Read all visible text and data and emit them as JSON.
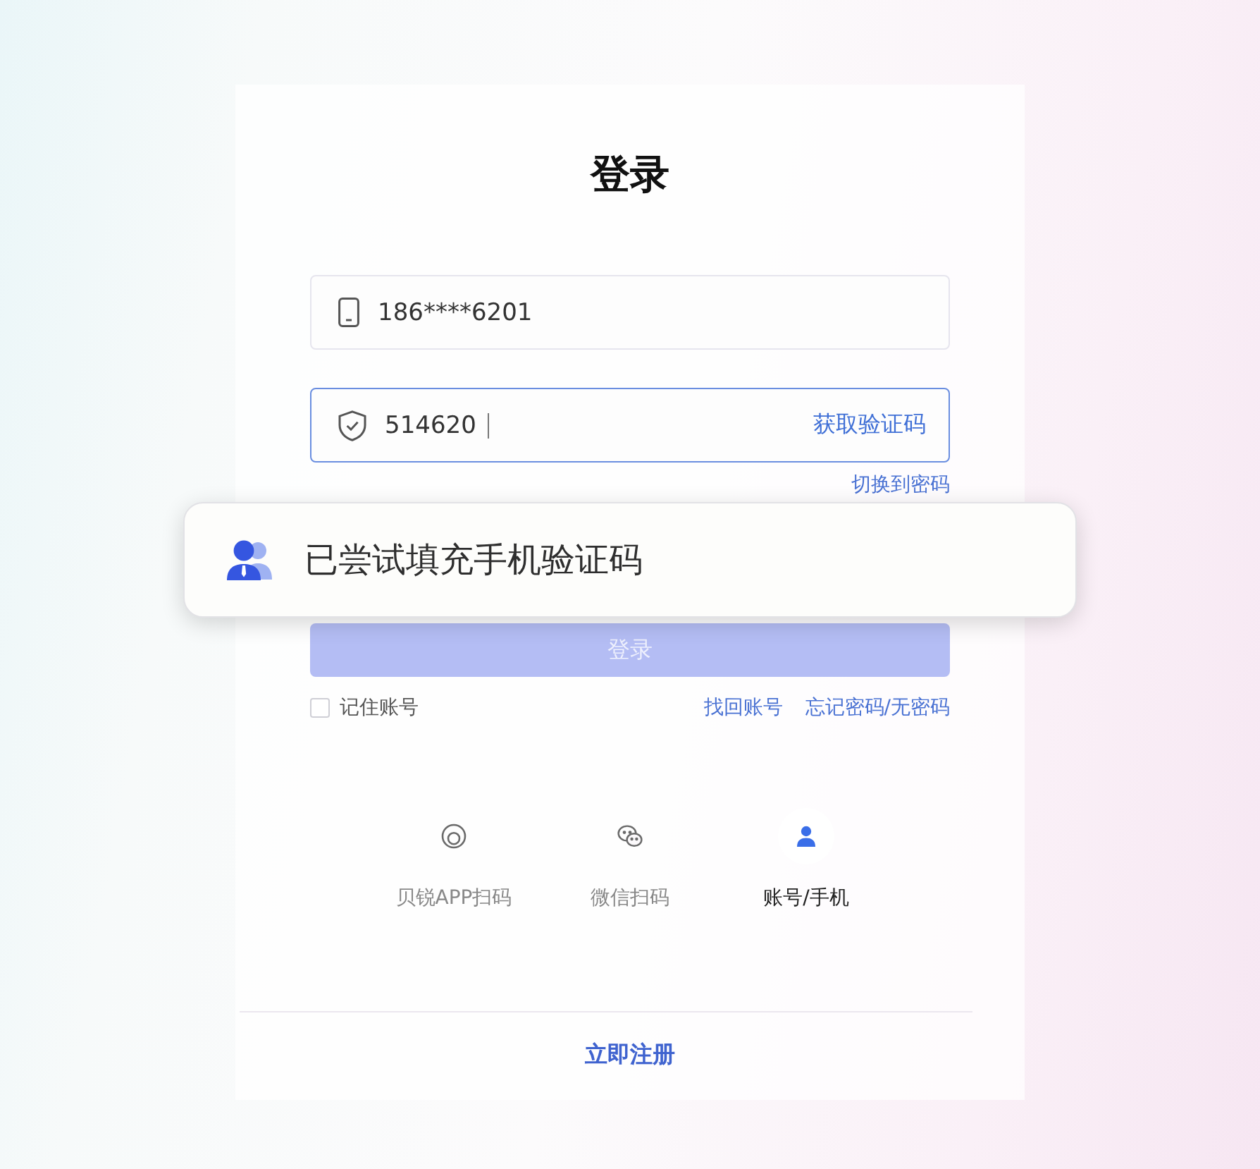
{
  "title": "登录",
  "fields": [
    {
      "kind": "phone",
      "value": "186****6201",
      "focused": false
    },
    {
      "kind": "code",
      "value": "514620",
      "focused": true,
      "action": "获取验证码"
    }
  ],
  "switch_link": "切换到密码",
  "toast": {
    "message": "已尝试填充手机验证码"
  },
  "login_button": {
    "label": "登录",
    "disabled": true
  },
  "remember": {
    "label": "记住账号",
    "checked": false
  },
  "links": [
    "找回账号",
    "忘记密码/无密码"
  ],
  "methods": [
    {
      "kind": "app-scan",
      "label": "贝锐APP扫码",
      "selected": false
    },
    {
      "kind": "wechat",
      "label": "微信扫码",
      "selected": false
    },
    {
      "kind": "account",
      "label": "账号/手机",
      "selected": true
    }
  ],
  "register_link": "立即注册"
}
